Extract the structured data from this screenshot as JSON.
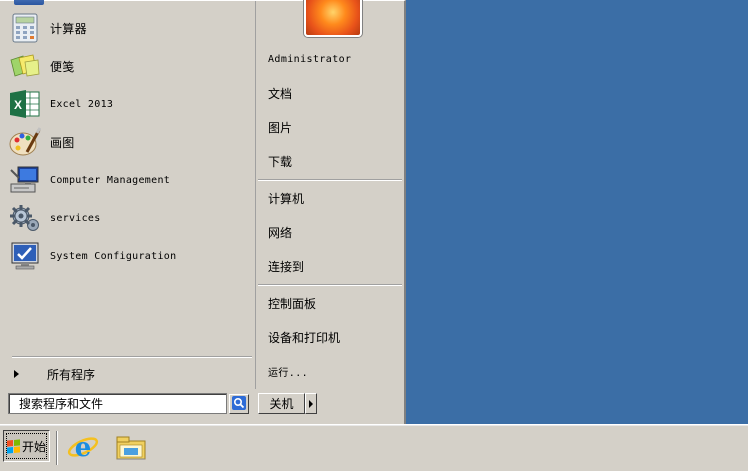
{
  "start_menu": {
    "pinned_programs": [
      {
        "label": "计算器",
        "icon": "calculator-icon"
      },
      {
        "label": "便笺",
        "icon": "sticky-notes-icon"
      },
      {
        "label": "Excel 2013",
        "icon": "excel-icon"
      },
      {
        "label": "画图",
        "icon": "paint-icon"
      },
      {
        "label": "Computer Management",
        "icon": "computer-management-icon"
      },
      {
        "label": "services",
        "icon": "services-gear-icon"
      },
      {
        "label": "System Configuration",
        "icon": "system-configuration-icon"
      }
    ],
    "all_programs_label": "所有程序",
    "search_placeholder": "搜索程序和文件",
    "shutdown_label": "关机",
    "places": {
      "user": "Administrator",
      "documents": "文档",
      "pictures": "图片",
      "downloads": "下载",
      "computer": "计算机",
      "network": "网络",
      "connect_to": "连接到",
      "control_panel": "控制面板",
      "devices_printers": "设备和打印机",
      "run": "运行..."
    }
  },
  "taskbar": {
    "start_label": "开始",
    "pinned": [
      {
        "icon": "internet-explorer-icon"
      },
      {
        "icon": "windows-explorer-icon"
      }
    ]
  },
  "colors": {
    "desktop": "#3b6ea6",
    "menu_face": "#d4d0c8"
  }
}
